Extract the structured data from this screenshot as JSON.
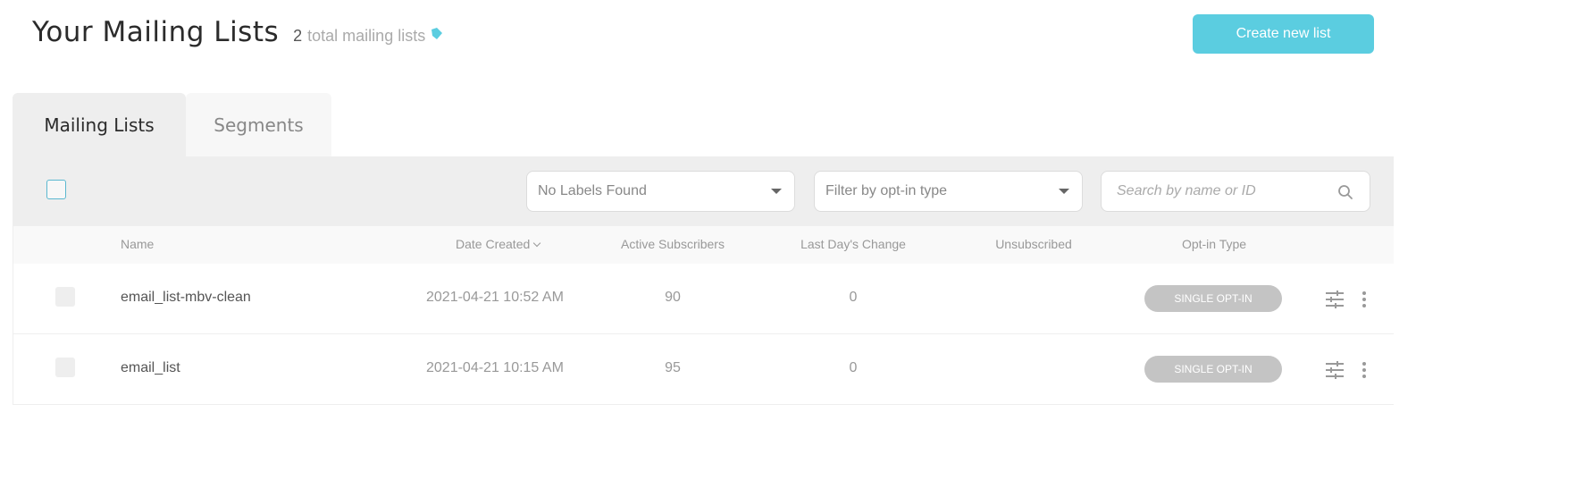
{
  "header": {
    "title": "Your Mailing Lists",
    "count": "2",
    "count_label": "total mailing lists",
    "create_button": "Create new list"
  },
  "tabs": [
    {
      "label": "Mailing Lists",
      "active": true
    },
    {
      "label": "Segments",
      "active": false
    }
  ],
  "filters": {
    "labels_select": "No Labels Found",
    "optin_select": "Filter by opt-in type",
    "search_placeholder": "Search by name or ID"
  },
  "table": {
    "columns": {
      "name": "Name",
      "date_created": "Date Created",
      "active_subscribers": "Active Subscribers",
      "last_day_change": "Last Day's Change",
      "unsubscribed": "Unsubscribed",
      "optin_type": "Opt-in Type"
    },
    "rows": [
      {
        "name": "email_list-mbv-clean",
        "date": "2021-04-21 10:52 AM",
        "active": "90",
        "change": "0",
        "unsubscribed": "",
        "optin": "SINGLE OPT-IN"
      },
      {
        "name": "email_list",
        "date": "2021-04-21 10:15 AM",
        "active": "95",
        "change": "0",
        "unsubscribed": "",
        "optin": "SINGLE OPT-IN"
      }
    ]
  },
  "icons": {
    "tag": "tag-icon",
    "search": "search-icon",
    "settings": "sliders-icon",
    "more": "more-vertical-icon",
    "sort": "chevron-down-icon"
  },
  "colors": {
    "accent": "#5bcde0",
    "badge": "#c4c4c4",
    "toolbar_bg": "#eeeeee"
  }
}
